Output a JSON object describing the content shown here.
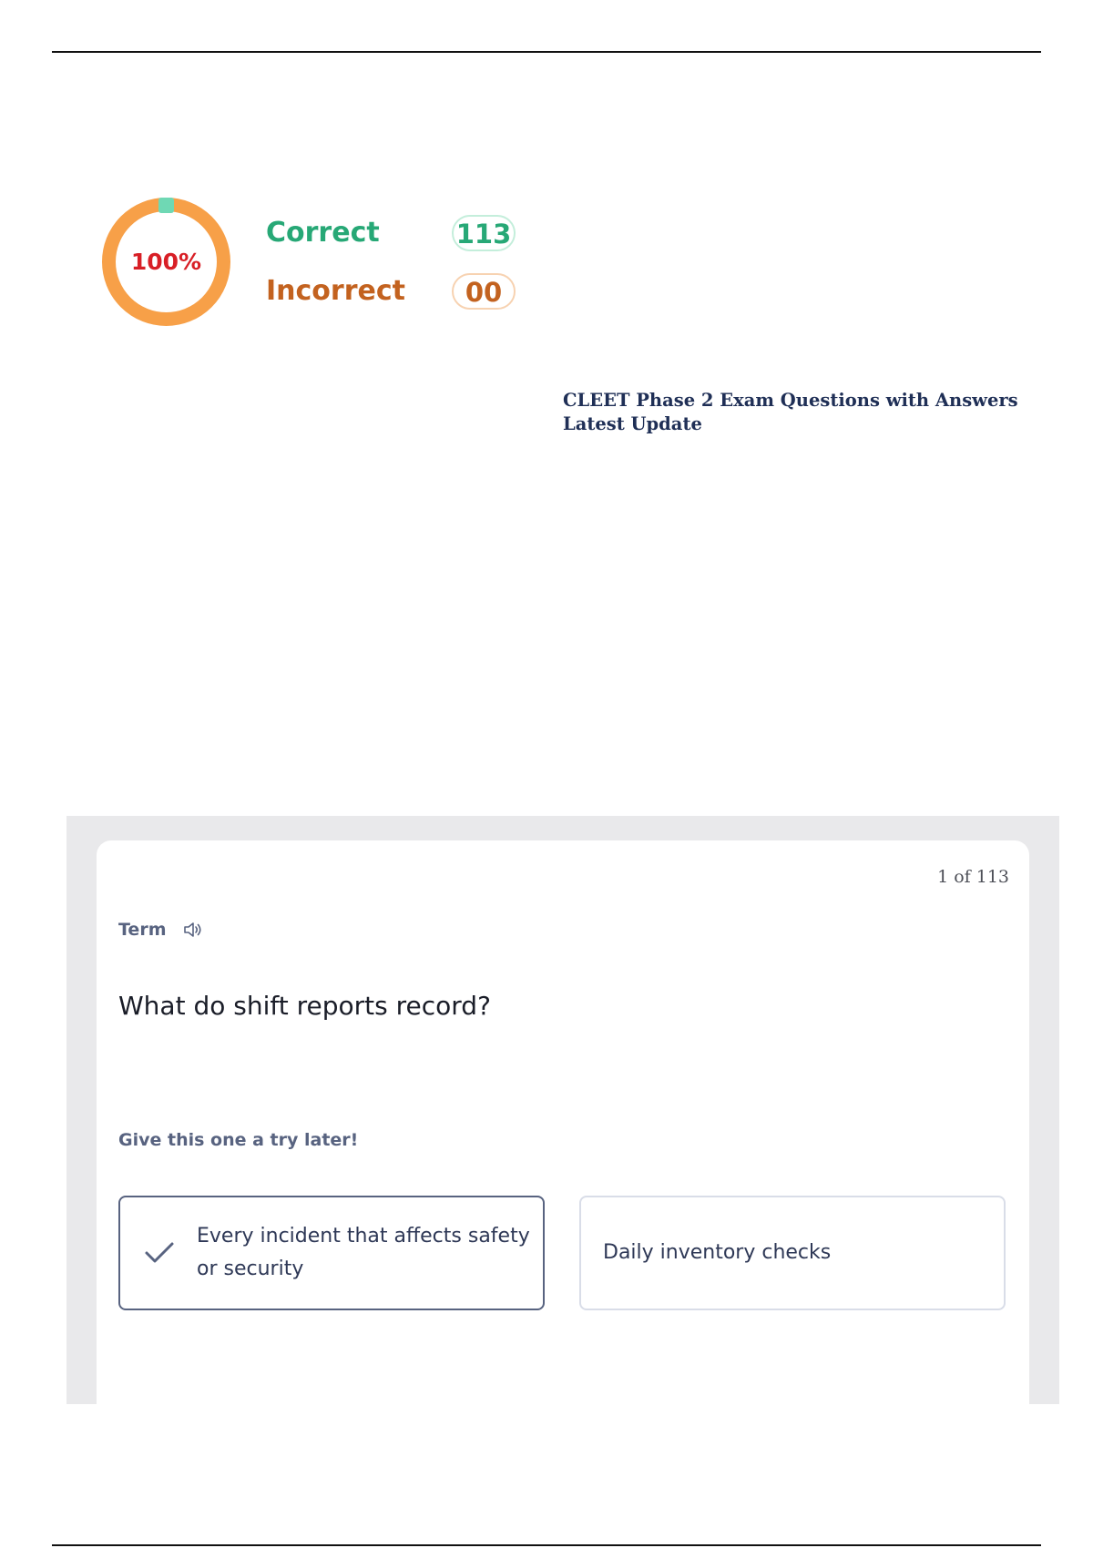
{
  "score": {
    "percent_label": "100%",
    "percent_value": 100,
    "correct_label": "Correct",
    "correct_count": "113",
    "incorrect_label": "Incorrect",
    "incorrect_count": "00",
    "colors": {
      "ring": "#f7a048",
      "ring_marker": "#6fd8b4",
      "percent_text": "#d81f26",
      "correct": "#27a876",
      "incorrect": "#c3621f"
    }
  },
  "document": {
    "title": "CLEET Phase 2 Exam Questions with Answers Latest Update"
  },
  "card": {
    "counter": "1 of 113",
    "term_label": "Term",
    "audio_icon": "speaker-icon",
    "question": "What do shift reports record?",
    "hint": "Give this one a try later!",
    "options": [
      {
        "text": "Every incident that affects safety or security",
        "icon": "check-icon",
        "selected": true
      },
      {
        "text": "Daily inventory checks",
        "selected": false
      }
    ]
  }
}
